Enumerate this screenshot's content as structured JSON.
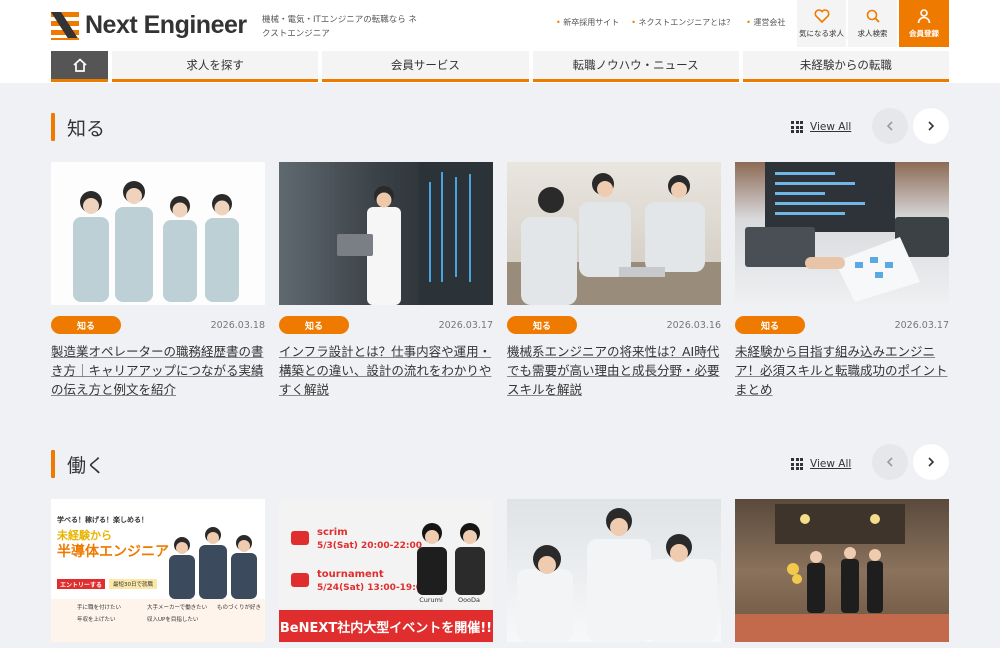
{
  "brand": {
    "name": "Next Engineer",
    "tagline": "機械・電気・ITエンジニアの転職なら ネクストエンジニア"
  },
  "top_links": [
    "新卒採用サイト",
    "ネクストエンジニアとは？",
    "運営会社"
  ],
  "header_buttons": {
    "favorites": "気になる求人",
    "search": "求人検索",
    "register": "会員登録"
  },
  "nav": [
    "求人を探す",
    "会員サービス",
    "転職ノウハウ・ニュース",
    "未経験からの転職"
  ],
  "sections": [
    {
      "title": "知る",
      "view_all": "View All",
      "cards": [
        {
          "tag": "知る",
          "date": "2026.03.18",
          "title": "製造業オペレーターの職務経歴書の書き方｜キャリアアップにつながる実績の伝え方と例文を紹介"
        },
        {
          "tag": "知る",
          "date": "2026.03.17",
          "title": "インフラ設計とは？仕事内容や運用・構築との違い、設計の流れをわかりやすく解説"
        },
        {
          "tag": "知る",
          "date": "2026.03.16",
          "title": "機械系エンジニアの将来性は？AI時代でも需要が高い理由と成長分野・必要スキルを解説"
        },
        {
          "tag": "知る",
          "date": "2026.03.17",
          "title": "未経験から目指す組み込みエンジニア！必須スキルと転職成功のポイントまとめ"
        }
      ]
    },
    {
      "title": "働く",
      "view_all": "View All",
      "banners": {
        "b1_top": "学べる！稼げる！楽しめる！",
        "b1_main1": "未経験から",
        "b1_main2": "半導体エンジニア",
        "b1_btn": "エントリーする",
        "b1_badge": "最短30日で就職",
        "b1_checks": [
          "手に職を付けたい",
          "大手メーカーで働きたい",
          "ものづくりが好き",
          "年収を上げたい",
          "収入UPを目指したい"
        ],
        "b2_scrim": "scrim",
        "b2_scrim_time": "5/3(Sat) 20:00-22:00",
        "b2_tour": "tournament",
        "b2_tour_time": "5/24(Sat) 13:00-19:00",
        "b2_p1": "Curumi",
        "b2_p2": "OooDa",
        "b2_bottom": "BeNEXT社内大型イベントを開催!!"
      }
    }
  ],
  "colors": {
    "accent": "#ef7a00",
    "bg": "#f0f1f4"
  }
}
